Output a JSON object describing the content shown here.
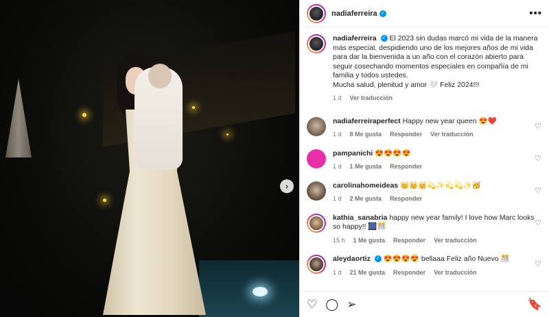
{
  "post": {
    "author": "nadiaferreira",
    "more_icon": "more-horizontal-icon"
  },
  "caption": {
    "author": "nadiaferreira",
    "text": "El 2023 sin dudas marcó mi vida de la manera más especial, despidiendo uno de los mejores años de mi vida para dar la bienvenida a un año con el corazón abierto para seguir cosechando momentos especiales en compañía de mi familia y todos ustedes.",
    "text2": "Mucha salud, plenitud y amor 🤍 Feliz 2024!!!",
    "time": "1 d",
    "translate": "Ver traducción"
  },
  "comments": [
    {
      "user": "nadiaferreiraperfect",
      "text": "Happy new year queen 😍❤️",
      "time": "1 d",
      "likes": "8 Me gusta",
      "reply": "Responder",
      "translate": "Ver traducción"
    },
    {
      "user": "pampanichi",
      "text": "😍😍😍😍",
      "time": "1 d",
      "likes": "1 Me gusta",
      "reply": "Responder",
      "translate": ""
    },
    {
      "user": "carolinahomeideas",
      "text": "👑👑👑💫✨💫💫✨🥳",
      "time": "1 d",
      "likes": "2 Me gusta",
      "reply": "Responder",
      "translate": ""
    },
    {
      "user": "kathia_sanabria",
      "text": "happy new year family! I love how Marc looks so happy!! 🎆🎊",
      "time": "15 h",
      "likes": "1 Me gusta",
      "reply": "Responder",
      "translate": "Ver traducción"
    },
    {
      "user": "aleydaortiz",
      "text": "😍😍😍😍 bellaaa Feliz año Nuevo 🎊",
      "time": "1 d",
      "likes": "21 Me gusta",
      "reply": "Responder",
      "translate": "Ver traducción"
    }
  ],
  "icons": {
    "like": "♡",
    "comment": "◯",
    "share": "➢",
    "save": "🔖",
    "next": "›"
  }
}
